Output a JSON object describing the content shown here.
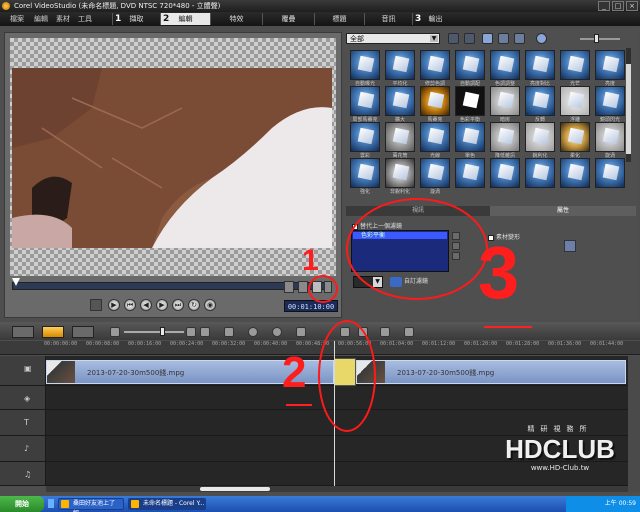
{
  "window": {
    "title": "Corel VideoStudio (未命名標題, DVD NTSC 720*480 - 立體聲)"
  },
  "menu": [
    "檔案",
    "編輯",
    "素材",
    "工具"
  ],
  "steps": [
    {
      "num": "1",
      "label": "擷取"
    },
    {
      "num": "2",
      "label": "編輯"
    },
    {
      "num": "",
      "label": "特效"
    },
    {
      "num": "",
      "label": "覆疊"
    },
    {
      "num": "",
      "label": "標題"
    },
    {
      "num": "",
      "label": "音訊"
    },
    {
      "num": "3",
      "label": "輸出"
    }
  ],
  "library": {
    "category": "全部",
    "filters": [
      "自動曝光",
      "平均化",
      "修剪色調",
      "自動調配",
      "色調調整",
      "亮度對比",
      "光芒",
      "亮度",
      "局部馬賽克",
      "擴大",
      "馬賽克",
      "色彩平衡",
      "暗房",
      "反轉",
      "浮雕",
      "鏡頭閃光",
      "雲彩",
      "萬花筒",
      "光線",
      "單色",
      "降低雜訊",
      "銳利化",
      "柔化",
      "旋渦",
      "強化",
      "非銳利化",
      "漩渦"
    ]
  },
  "options": {
    "tab_video": "視訊",
    "tab_attr": "屬性",
    "replace_label": "替代上一個濾鏡",
    "filter_item": "色彩平衡",
    "custom_label": "自訂濾鏡",
    "deform_label": "素材變形"
  },
  "player": {
    "timecode": "00:01:10:00"
  },
  "ruler": {
    "ticks": [
      "00:00:00:00",
      "00:00:08:00",
      "00:00:16:00",
      "00:00:24:00",
      "00:00:32:00",
      "00:00:40:00",
      "00:00:48:00",
      "00:00:56:00",
      "00:01:04:00",
      "00:01:12:00",
      "00:01:20:00",
      "00:01:28:00",
      "00:01:36:00",
      "00:01:44:00"
    ]
  },
  "timeline": {
    "clip1": "2013-07-20-30m500錢.mpg",
    "clip2": "2013-07-20-30m500錢.mpg"
  },
  "annotations": {
    "one": "1",
    "two": "2",
    "three": "3"
  },
  "watermark": {
    "top": "精研視務所",
    "big": "HDCLUB",
    "url": "www.HD-Club.tw"
  },
  "taskbar": {
    "start": "開始",
    "task1": "桑田好友池上了解...",
    "task2": "未命名標題 - Corel Y...",
    "clock": "上午 00:59"
  },
  "colors": {
    "annotation": "#ff1e1e",
    "playbar": "#2c3a55",
    "clip": "#8aa2d0",
    "transition": "#e8d86a"
  }
}
